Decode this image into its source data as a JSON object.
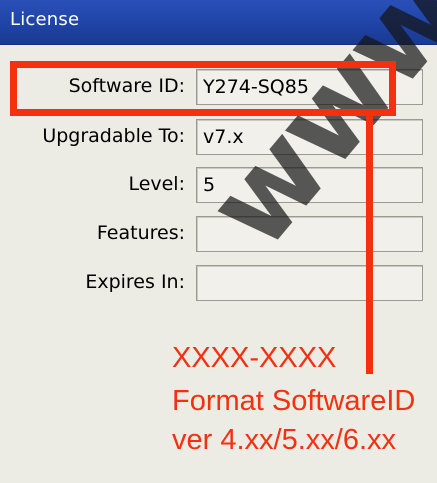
{
  "window": {
    "title": "License"
  },
  "fields": [
    {
      "label": "Software ID:",
      "value": "Y274-SQ85"
    },
    {
      "label": "Upgradable To:",
      "value": "v7.x"
    },
    {
      "label": "Level:",
      "value": "5"
    },
    {
      "label": "Features:",
      "value": ""
    },
    {
      "label": "Expires In:",
      "value": ""
    }
  ],
  "watermark": "www",
  "annotation": {
    "line1": "XXXX-XXXX",
    "line2": "Format SoftwareID",
    "line3": "ver 4.xx/5.xx/6.xx",
    "color": "#f3300f"
  }
}
